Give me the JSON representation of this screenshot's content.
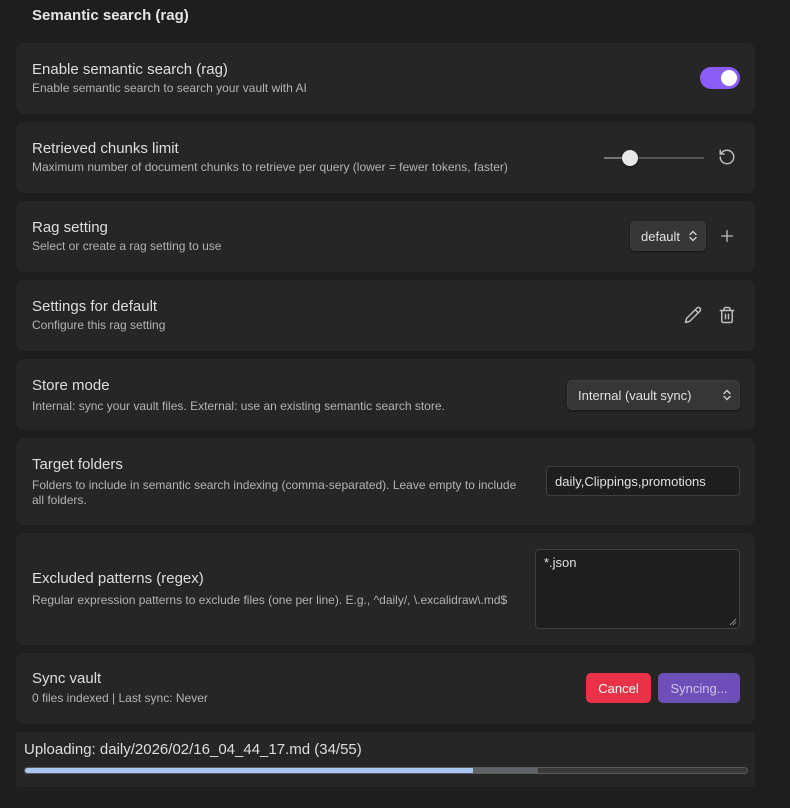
{
  "section": {
    "title": "Semantic search (rag)"
  },
  "enable": {
    "name": "Enable semantic search (rag)",
    "desc": "Enable semantic search to search your vault with AI",
    "enabled": true
  },
  "chunks": {
    "name": "Retrieved chunks limit",
    "desc": "Maximum number of document chunks to retrieve per query (lower = fewer tokens, faster)",
    "slider_fraction": 0.26,
    "reset_icon": "reset-icon"
  },
  "rag": {
    "name": "Rag setting",
    "desc": "Select or create a rag setting to use",
    "selected": "default",
    "add_icon": "plus-icon"
  },
  "settings_for": {
    "name": "Settings for default",
    "desc": "Configure this rag setting",
    "edit_icon": "pencil-icon",
    "delete_icon": "trash-icon"
  },
  "store": {
    "name": "Store mode",
    "desc": "Internal: sync your vault files. External: use an existing semantic search store.",
    "selected": "Internal (vault sync)"
  },
  "target": {
    "name": "Target folders",
    "desc": "Folders to include in semantic search indexing (comma-separated). Leave empty to include all folders.",
    "value": "daily,Clippings,promotions"
  },
  "excluded": {
    "name": "Excluded patterns (regex)",
    "desc": "Regular expression patterns to exclude files (one per line). E.g., ^daily/, \\.excalidraw\\.md$",
    "value": "*.json"
  },
  "sync": {
    "name": "Sync vault",
    "desc": "0 files indexed | Last sync: Never",
    "cancel_label": "Cancel",
    "syncing_label": "Syncing..."
  },
  "upload": {
    "text": "Uploading: daily/2026/02/16_04_44_17.md (34/55)",
    "progress": 0.62,
    "buffered": 0.71
  },
  "colors": {
    "accent": "#8b5cf6",
    "cancel": "#e93147",
    "syncing": "#6e4eb8",
    "progress": "#a8c7f0"
  }
}
